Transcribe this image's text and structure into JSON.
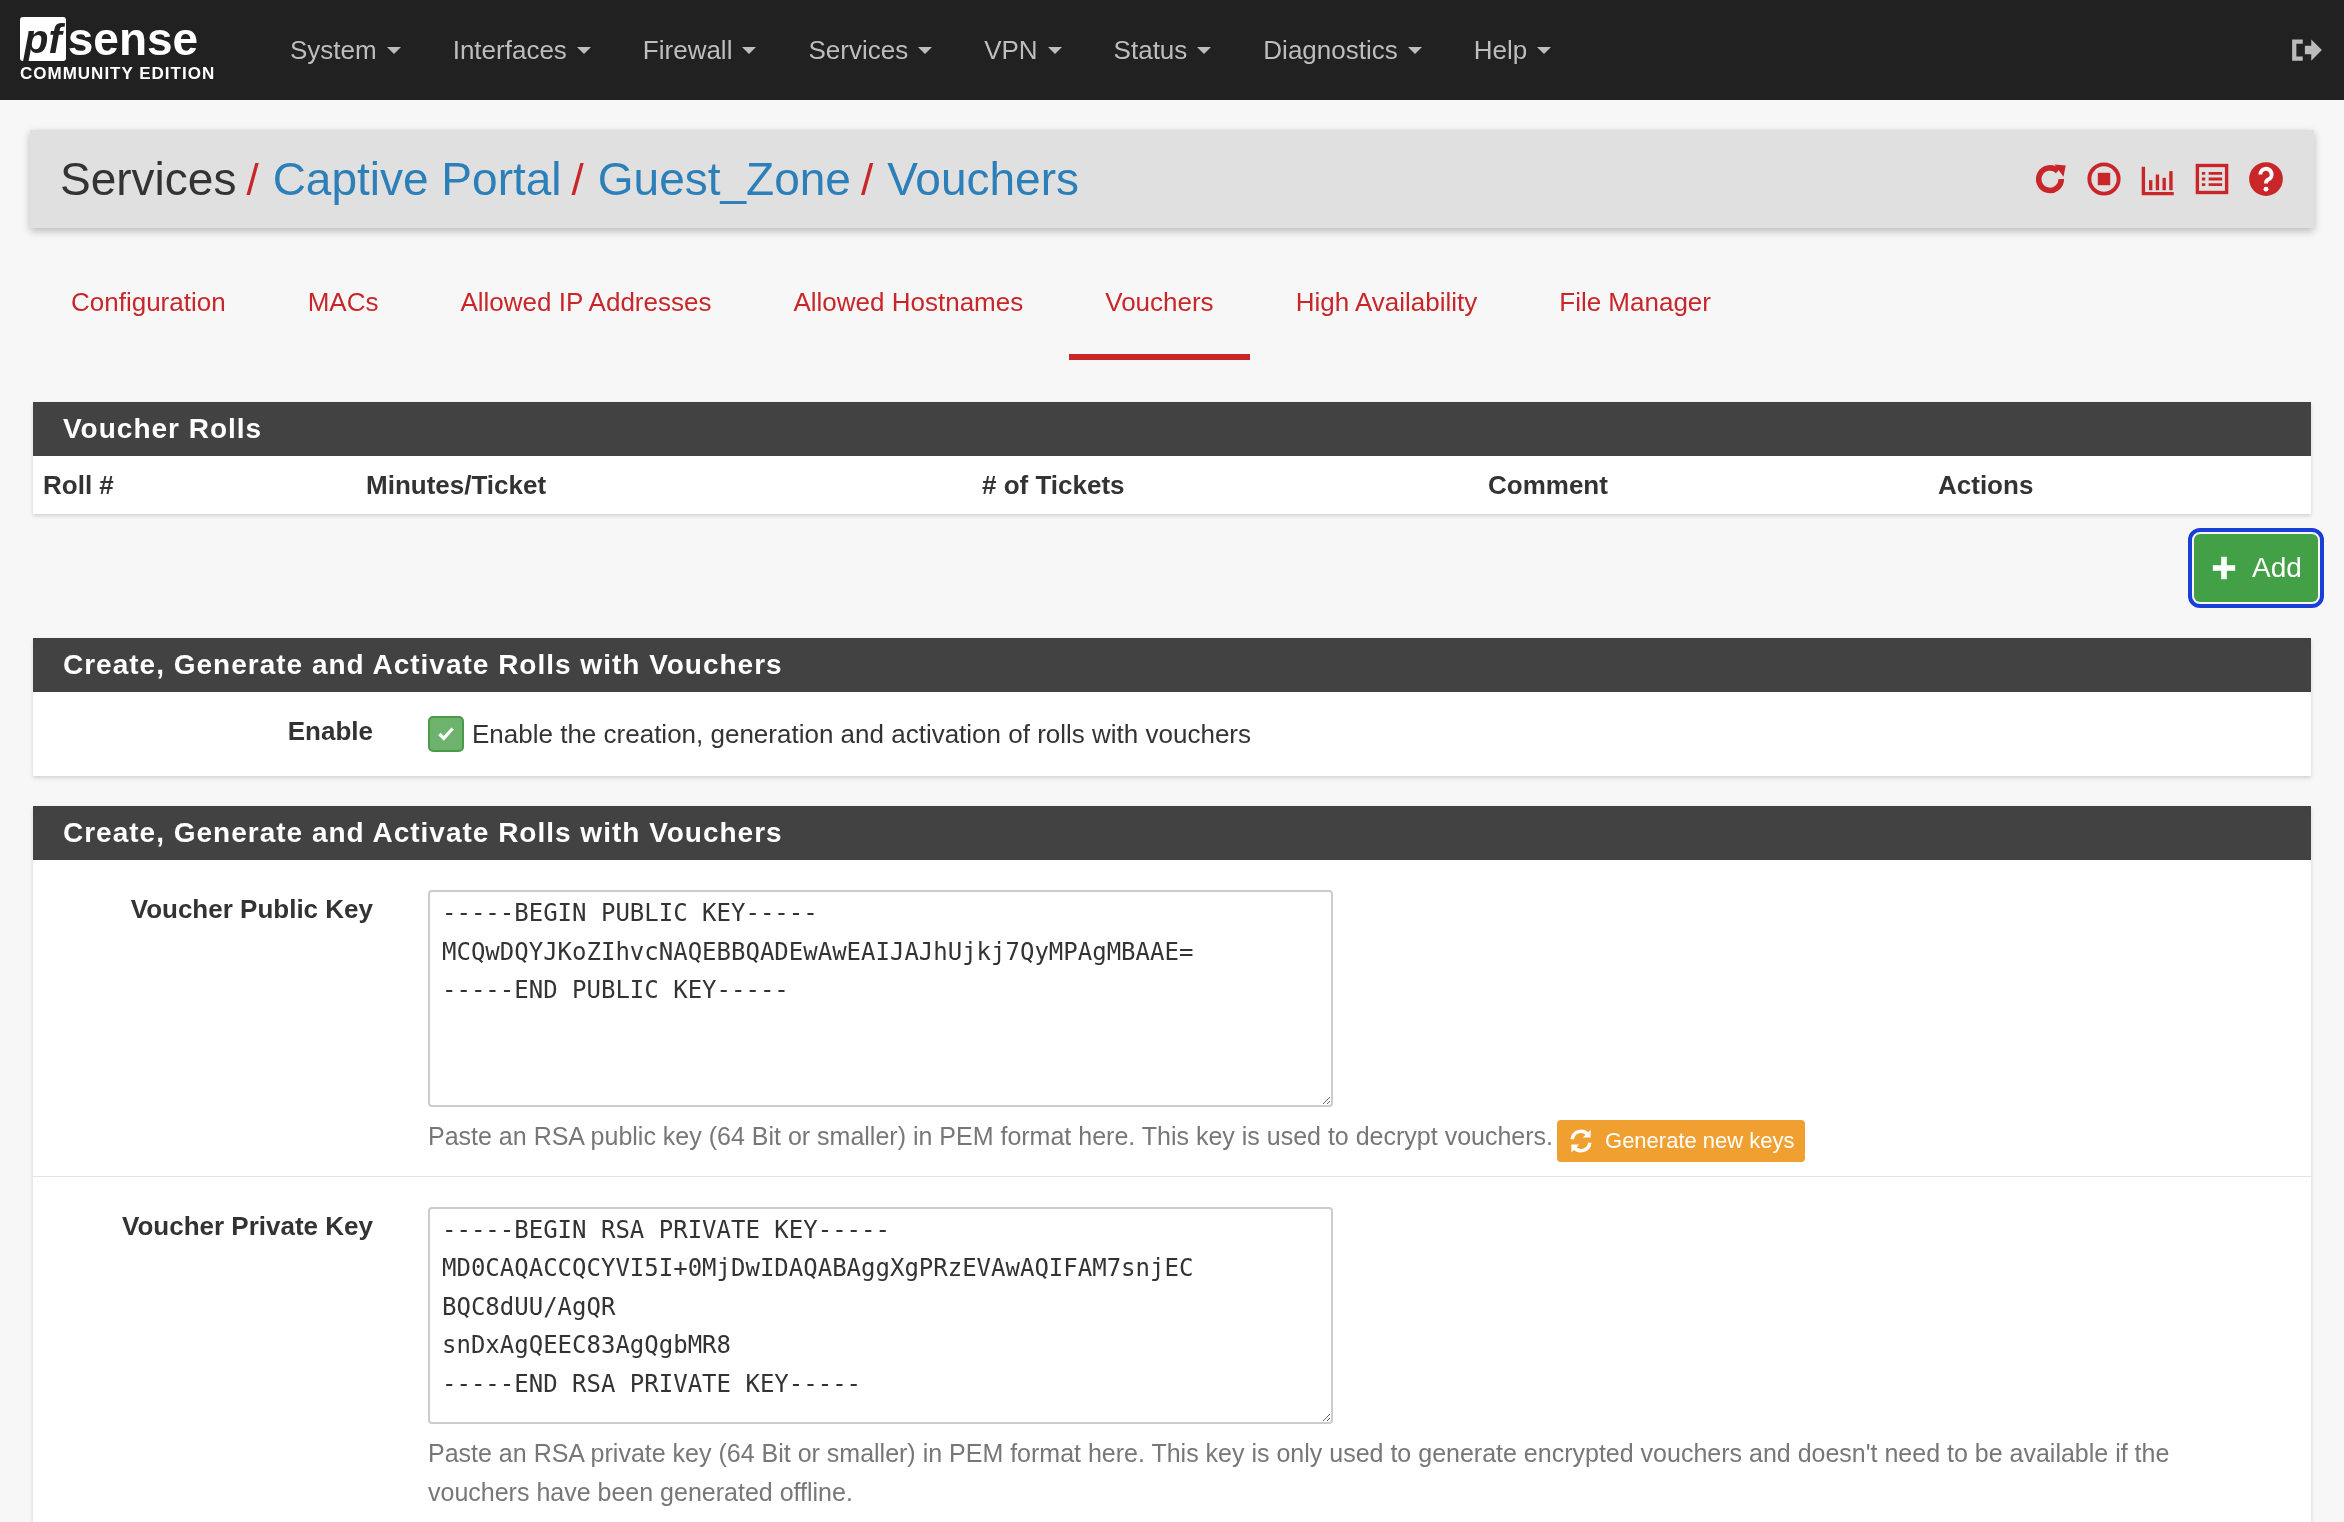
{
  "logo": {
    "mark": "pf",
    "name": "sense",
    "edition": "COMMUNITY EDITION"
  },
  "nav": [
    {
      "label": "System"
    },
    {
      "label": "Interfaces"
    },
    {
      "label": "Firewall"
    },
    {
      "label": "Services"
    },
    {
      "label": "VPN"
    },
    {
      "label": "Status"
    },
    {
      "label": "Diagnostics"
    },
    {
      "label": "Help"
    }
  ],
  "breadcrumb": [
    {
      "label": "Services",
      "separator": "/",
      "link": false
    },
    {
      "label": "Captive Portal",
      "separator": "/",
      "link": true
    },
    {
      "label": "Guest_Zone",
      "separator": "/",
      "link": true
    },
    {
      "label": "Vouchers",
      "link": true
    }
  ],
  "tabs": [
    {
      "label": "Configuration",
      "selected": false
    },
    {
      "label": "MACs",
      "selected": false
    },
    {
      "label": "Allowed IP Addresses",
      "selected": false
    },
    {
      "label": "Allowed Hostnames",
      "selected": false
    },
    {
      "label": "Vouchers",
      "selected": true
    },
    {
      "label": "High Availability",
      "selected": false
    },
    {
      "label": "File Manager",
      "selected": false
    }
  ],
  "rolls": {
    "title": "Voucher Rolls",
    "columns": [
      "Roll #",
      "Minutes/Ticket",
      "# of Tickets",
      "Comment",
      "Actions"
    ],
    "add_button": {
      "label": "Add",
      "focused": true
    }
  },
  "enable_section": {
    "title": "Create, Generate and Activate Rolls with Vouchers",
    "label": "Enable",
    "checked": true,
    "text": "Enable the creation, generation and activation of rolls with vouchers"
  },
  "keys_section": {
    "title": "Create, Generate and Activate Rolls with Vouchers",
    "fields": [
      {
        "label": "Voucher Public Key",
        "value": "-----BEGIN PUBLIC KEY-----\nMCQwDQYJKoZIhvcNAQEBBQADEwAwEAIJAJhUjkj7QyMPAgMBAAE=\n-----END PUBLIC KEY-----",
        "help": "Paste an RSA public key (64 Bit or smaller) in PEM format here. This key is used to decrypt vouchers.",
        "button": "Generate new keys"
      },
      {
        "label": "Voucher Private Key",
        "value": "-----BEGIN RSA PRIVATE KEY-----\nMD0CAQACCQCYVI5I+0MjDwIDAQABAggXgPRzEVAwAQIFAM7snjEC\nBQC8dUU/AgQR\nsnDxAgQEEC83AgQgbMR8\n-----END RSA PRIVATE KEY-----",
        "help": "Paste an RSA private key (64 Bit or smaller) in PEM format here. This key is only used to generate encrypted vouchers and doesn't need to be available if the vouchers have been generated offline."
      }
    ]
  }
}
